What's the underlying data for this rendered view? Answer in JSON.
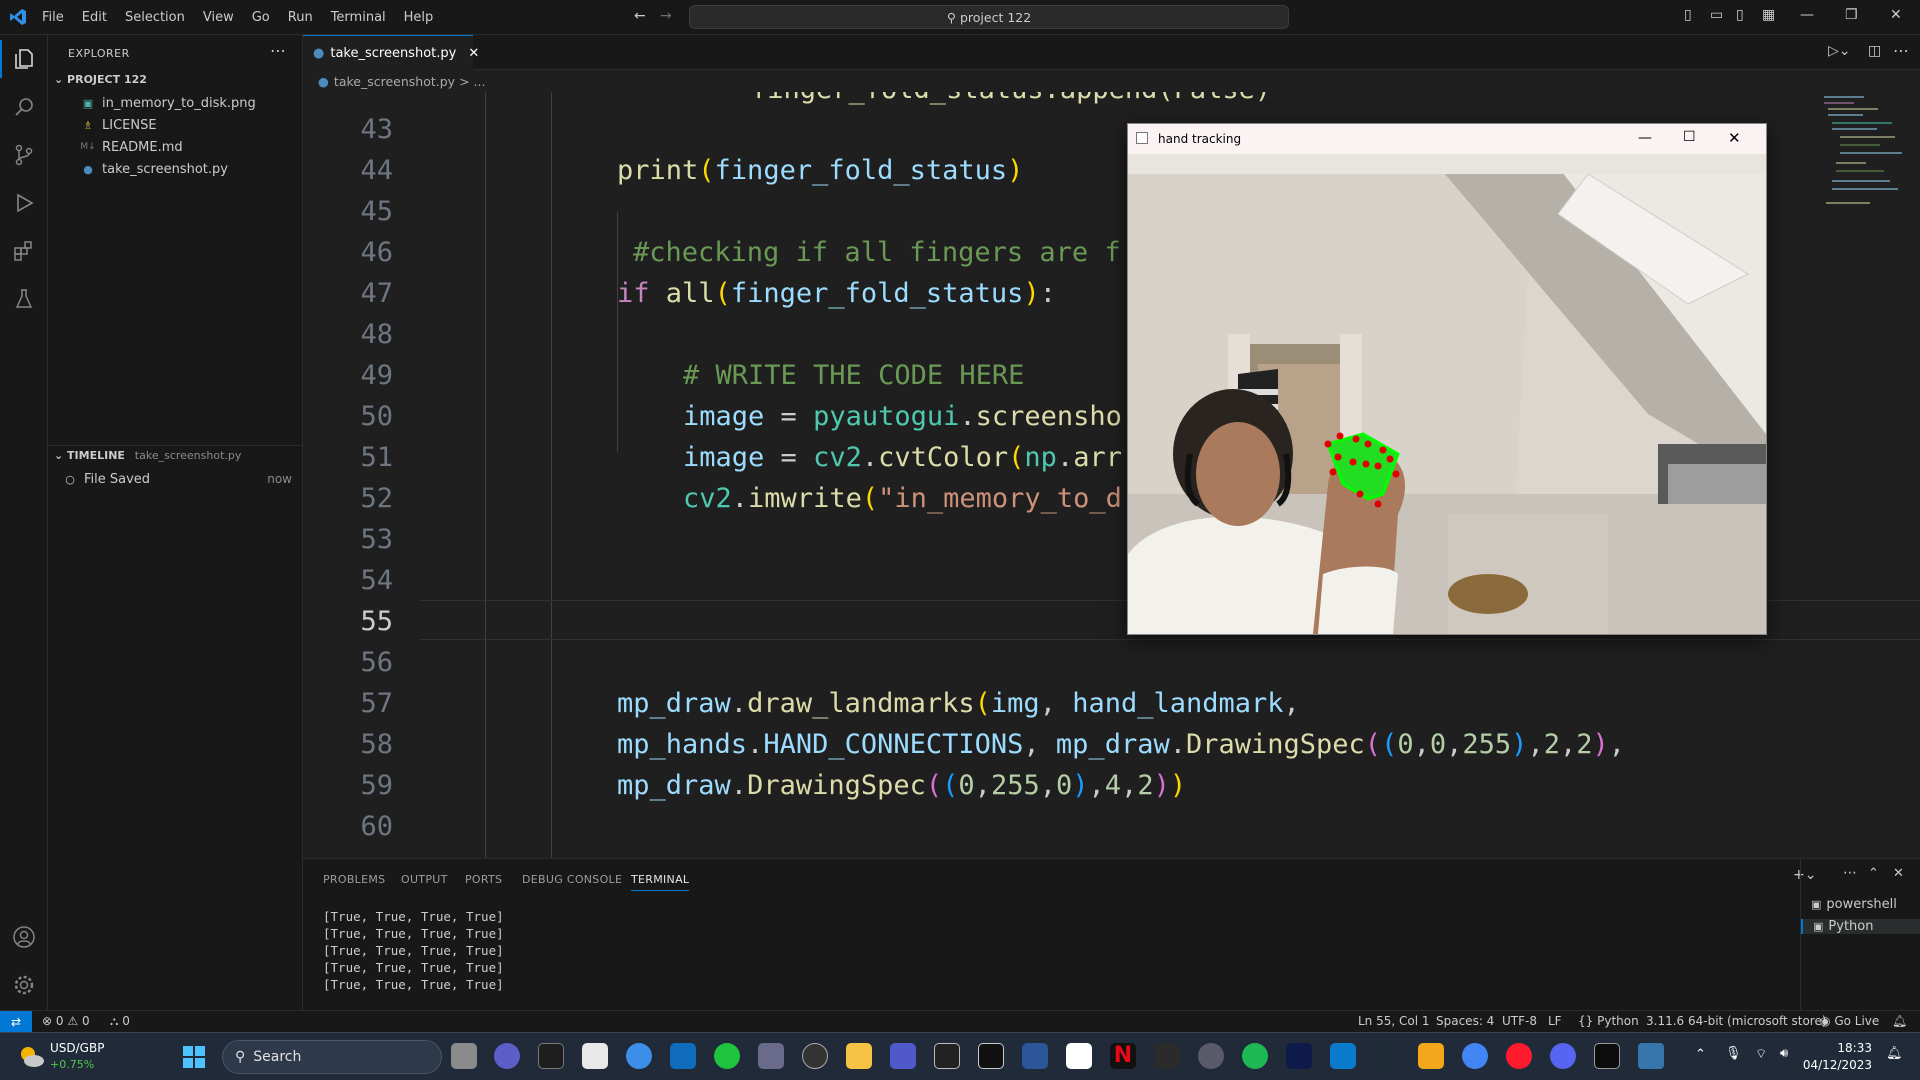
{
  "titlebar": {
    "menu": [
      "File",
      "Edit",
      "Selection",
      "View",
      "Go",
      "Run",
      "Terminal",
      "Help"
    ],
    "search_text": "project 122"
  },
  "sidebar": {
    "title": "EXPLORER",
    "project": "PROJECT 122",
    "files": [
      {
        "name": "in_memory_to_disk.png",
        "icon": "image-file-icon"
      },
      {
        "name": "LICENSE",
        "icon": "license-file-icon"
      },
      {
        "name": "README.md",
        "icon": "markdown-file-icon"
      },
      {
        "name": "take_screenshot.py",
        "icon": "python-file-icon"
      }
    ],
    "timeline_label": "TIMELINE",
    "timeline_file": "take_screenshot.py",
    "timeline_entry": "File Saved",
    "timeline_time": "now"
  },
  "editor": {
    "tab_label": "take_screenshot.py",
    "breadcrumb_file": "take_screenshot.py",
    "breadcrumb_rest": "> ...",
    "line_numbers": [
      "43",
      "44",
      "45",
      "46",
      "47",
      "48",
      "49",
      "50",
      "51",
      "52",
      "53",
      "54",
      "55",
      "56",
      "57",
      "58",
      "59",
      "60"
    ],
    "partial_top": "finger_fold_status.append(False)"
  },
  "cv_window": {
    "title": "hand tracking"
  },
  "panel": {
    "tabs": [
      "PROBLEMS",
      "OUTPUT",
      "PORTS",
      "DEBUG CONSOLE",
      "TERMINAL"
    ],
    "active_tab": "TERMINAL",
    "terminal_lines": [
      "[True, True, True, True]",
      "[True, True, True, True]",
      "[True, True, True, True]",
      "[True, True, True, True]",
      "[True, True, True, True]"
    ],
    "terminals": [
      "powershell",
      "Python"
    ]
  },
  "statusbar": {
    "errors": "0",
    "warnings": "0",
    "ports": "0",
    "position": "Ln 55, Col 1",
    "spaces": "Spaces: 4",
    "encoding": "UTF-8",
    "eol": "LF",
    "language": "Python",
    "interpreter": "3.11.6 64-bit (microsoft store)",
    "golive": "Go Live"
  },
  "taskbar": {
    "stock_name": "USD/GBP",
    "stock_change": "+0.75%",
    "search_label": "Search",
    "time": "18:33",
    "date": "04/12/2023"
  }
}
